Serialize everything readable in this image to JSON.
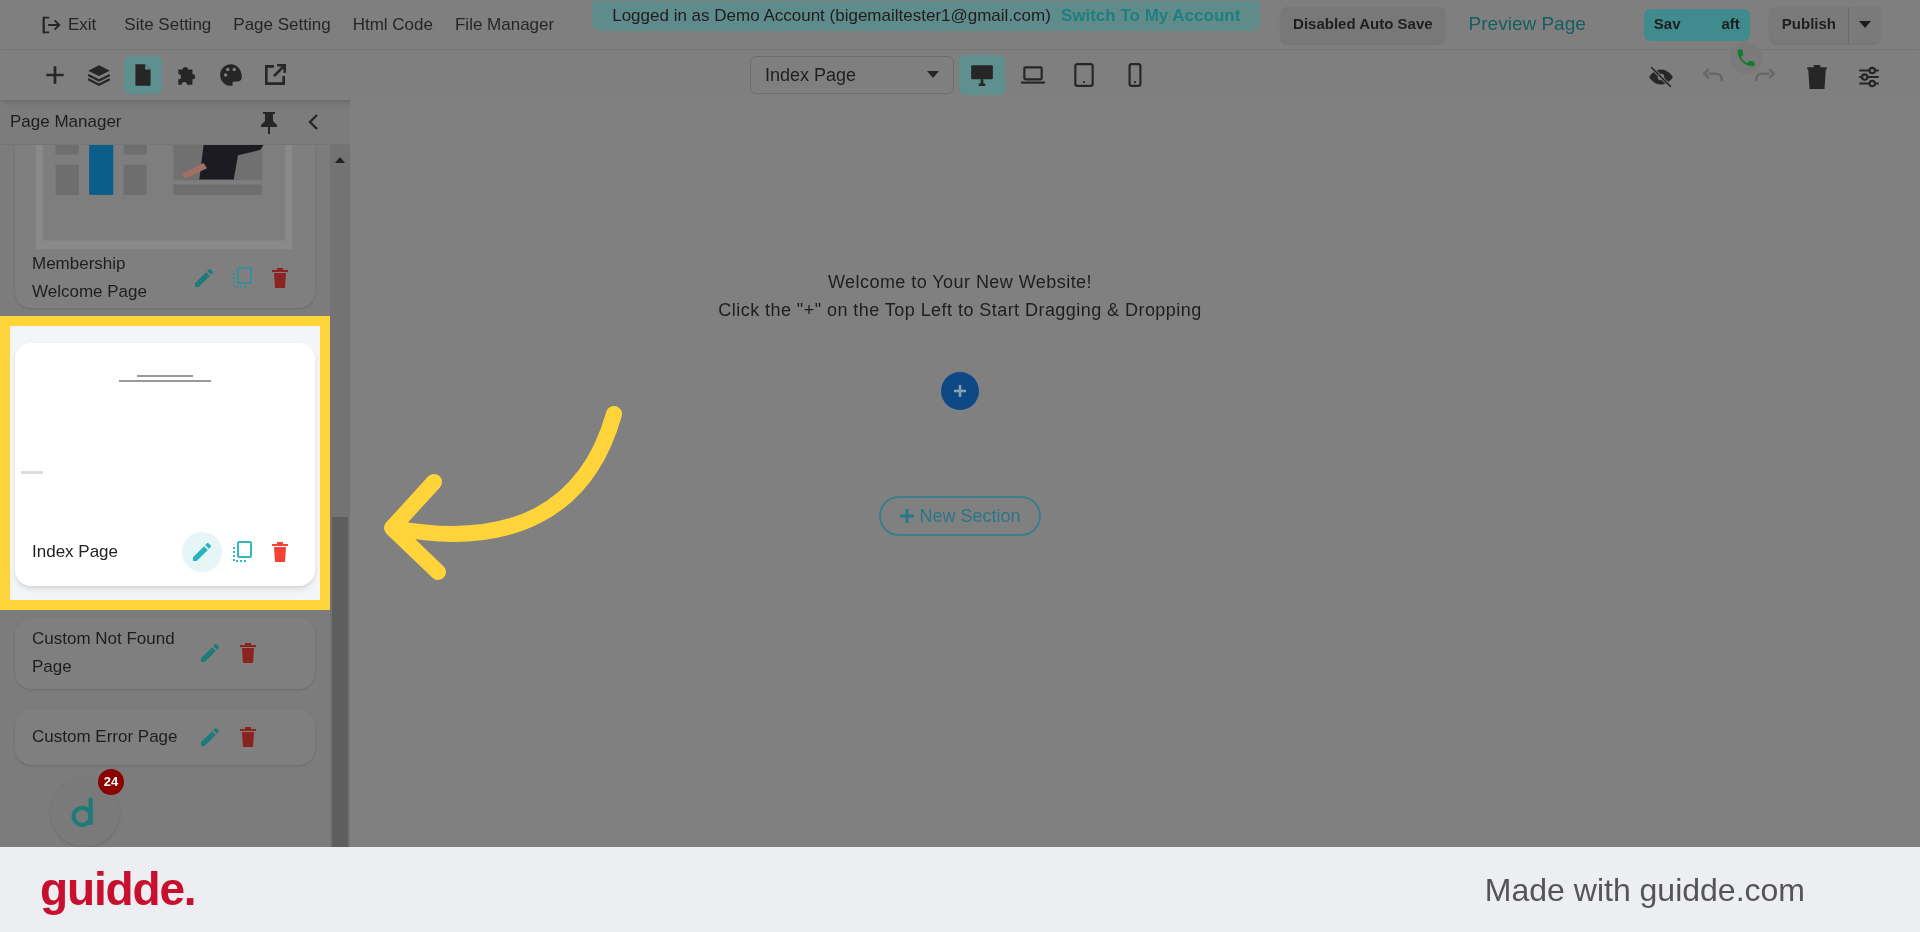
{
  "top_menu": {
    "exit": "Exit",
    "items": [
      "Site Setting",
      "Page Setting",
      "Html Code",
      "File Manager"
    ]
  },
  "login_banner": {
    "text": "Logged in as Demo Account (bigemailtester1@gmail.com)",
    "link": "Switch To My Account"
  },
  "autosave_button": "Disabled Auto Save",
  "preview_link": "Preview Page",
  "save_button": {
    "label_start": "Sav",
    "label_end": "aft"
  },
  "publish_button": "Publish",
  "tools": [
    {
      "kind": "add",
      "selected": false
    },
    {
      "kind": "layers",
      "selected": false
    },
    {
      "kind": "page",
      "selected": true
    },
    {
      "kind": "plugin",
      "selected": false
    },
    {
      "kind": "palette",
      "selected": false
    },
    {
      "kind": "export",
      "selected": false
    }
  ],
  "page_select": {
    "value": "Index Page"
  },
  "devices": [
    {
      "kind": "desktop",
      "selected": true
    },
    {
      "kind": "laptop",
      "selected": false
    },
    {
      "kind": "tablet",
      "selected": false
    },
    {
      "kind": "phone",
      "selected": false
    }
  ],
  "actions": [
    {
      "kind": "hide",
      "disabled": false
    },
    {
      "kind": "undo",
      "disabled": true
    },
    {
      "kind": "redo",
      "disabled": true
    },
    {
      "kind": "delete",
      "disabled": false
    },
    {
      "kind": "settings",
      "disabled": false
    }
  ],
  "sidebar": {
    "title": "Page Manager",
    "pages": [
      {
        "name": "Membership Welcome Page",
        "highlighted": false,
        "duplicate": true
      },
      {
        "name": "Index Page",
        "highlighted": true,
        "duplicate": true
      },
      {
        "name": "Custom Not Found Page",
        "duplicate": false,
        "highlighted": false
      },
      {
        "name": "Custom Error Page",
        "duplicate": false,
        "highlighted": false
      }
    ]
  },
  "chat_widget": {
    "badge": "24"
  },
  "canvas": {
    "welcome": "Welcome to Your New Website!",
    "hint": "Click the \"+\" on the Top Left to Start Dragging & Dropping",
    "new_section": "New Section"
  },
  "footer": {
    "logo": "guidde.",
    "credit": "Made with guidde.com"
  }
}
